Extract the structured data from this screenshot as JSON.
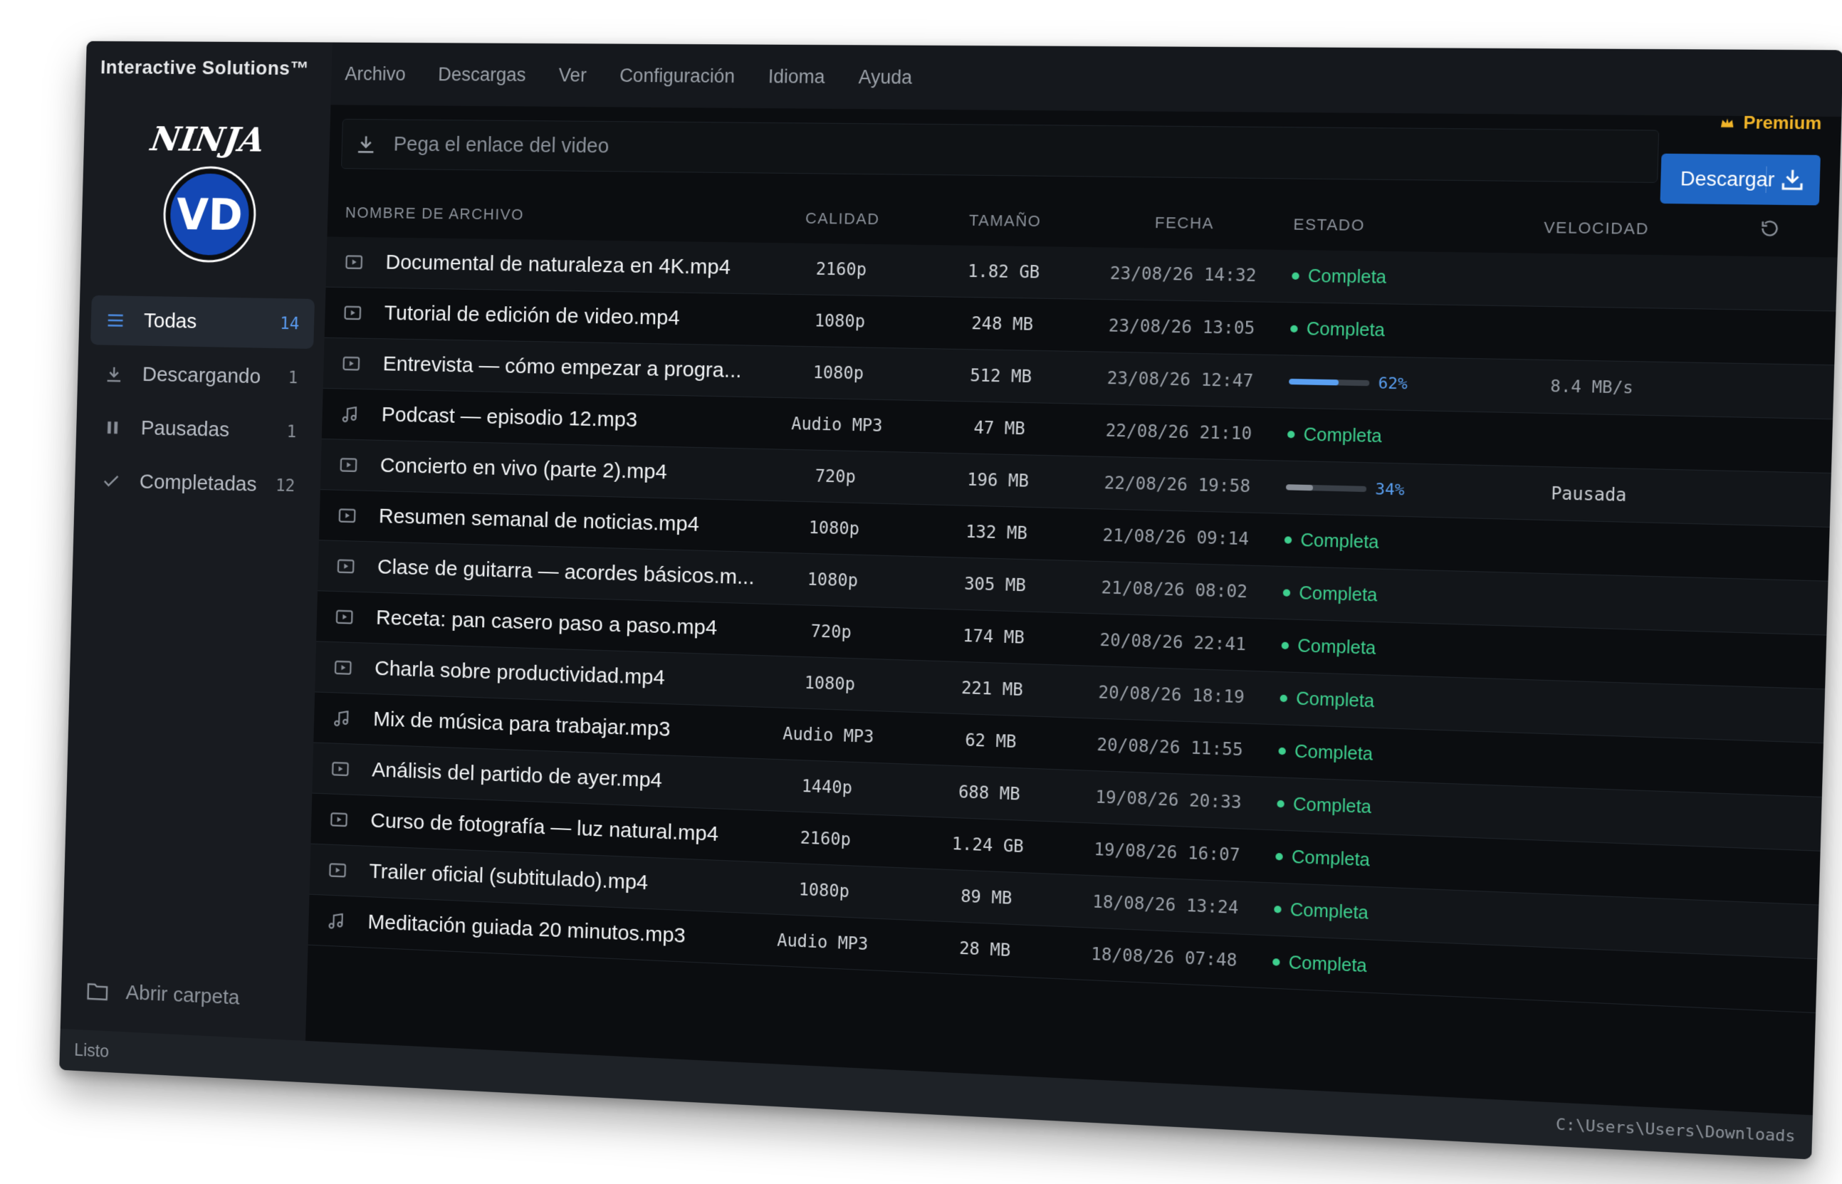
{
  "app": {
    "brand": "Interactive Solutions™",
    "logo_text_top": "NINJA",
    "logo_text_bottom": "VD"
  },
  "menu": [
    "Archivo",
    "Descargas",
    "Ver",
    "Configuración",
    "Idioma",
    "Ayuda"
  ],
  "sidebar": {
    "items": [
      {
        "label": "Todas",
        "count": "14",
        "icon": "list-icon",
        "active": true
      },
      {
        "label": "Descargando",
        "count": "1",
        "icon": "download-icon"
      },
      {
        "label": "Pausadas",
        "count": "1",
        "icon": "pause-icon"
      },
      {
        "label": "Completadas",
        "count": "12",
        "icon": "check-icon"
      }
    ],
    "open_folder": "Abrir carpeta"
  },
  "url_bar": {
    "placeholder": "Pega el enlace del video",
    "value": ""
  },
  "premium": {
    "label": "Premium",
    "color": "#f0b429"
  },
  "download_button": {
    "label": "Descargar",
    "color": "#1f66c4"
  },
  "table": {
    "headers": {
      "name": "NOMBRE DE ARCHIVO",
      "quality": "CALIDAD",
      "size": "TAMAÑO",
      "date": "FECHA",
      "status": "ESTADO",
      "speed": "VELOCIDAD"
    },
    "rows": [
      {
        "type": "video",
        "name": "Documental de naturaleza en 4K.mp4",
        "quality": "2160p",
        "size": "1.82 GB",
        "date": "23/08/26 14:32",
        "status": "Completa"
      },
      {
        "type": "video",
        "name": "Tutorial de edición de video.mp4",
        "quality": "1080p",
        "size": "248 MB",
        "date": "23/08/26 13:05",
        "status": "Completa"
      },
      {
        "type": "video",
        "name": "Entrevista — cómo empezar a progra...",
        "quality": "1080p",
        "size": "512 MB",
        "date": "23/08/26 12:47",
        "status": "progress",
        "progress": 62,
        "progress_label": "62%",
        "speed": "8.4 MB/s"
      },
      {
        "type": "audio",
        "name": "Podcast — episodio 12.mp3",
        "quality": "Audio MP3",
        "size": "47 MB",
        "date": "22/08/26 21:10",
        "status": "Completa"
      },
      {
        "type": "video",
        "name": "Concierto en vivo (parte 2).mp4",
        "quality": "720p",
        "size": "196 MB",
        "date": "22/08/26 19:58",
        "status": "paused",
        "progress": 34,
        "progress_label": "34%",
        "speed": "Pausada"
      },
      {
        "type": "video",
        "name": "Resumen semanal de noticias.mp4",
        "quality": "1080p",
        "size": "132 MB",
        "date": "21/08/26 09:14",
        "status": "Completa"
      },
      {
        "type": "video",
        "name": "Clase de guitarra — acordes básicos.m...",
        "quality": "1080p",
        "size": "305 MB",
        "date": "21/08/26 08:02",
        "status": "Completa"
      },
      {
        "type": "video",
        "name": "Receta: pan casero paso a paso.mp4",
        "quality": "720p",
        "size": "174 MB",
        "date": "20/08/26 22:41",
        "status": "Completa"
      },
      {
        "type": "video",
        "name": "Charla sobre productividad.mp4",
        "quality": "1080p",
        "size": "221 MB",
        "date": "20/08/26 18:19",
        "status": "Completa"
      },
      {
        "type": "audio",
        "name": "Mix de música para trabajar.mp3",
        "quality": "Audio MP3",
        "size": "62 MB",
        "date": "20/08/26 11:55",
        "status": "Completa"
      },
      {
        "type": "video",
        "name": "Análisis del partido de ayer.mp4",
        "quality": "1440p",
        "size": "688 MB",
        "date": "19/08/26 20:33",
        "status": "Completa"
      },
      {
        "type": "video",
        "name": "Curso de fotografía — luz natural.mp4",
        "quality": "2160p",
        "size": "1.24 GB",
        "date": "19/08/26 16:07",
        "status": "Completa"
      },
      {
        "type": "video",
        "name": "Trailer oficial (subtitulado).mp4",
        "quality": "1080p",
        "size": "89 MB",
        "date": "18/08/26 13:24",
        "status": "Completa"
      },
      {
        "type": "audio",
        "name": "Meditación guiada 20 minutos.mp3",
        "quality": "Audio MP3",
        "size": "28 MB",
        "date": "18/08/26 07:48",
        "status": "Completa"
      }
    ]
  },
  "statusbar": {
    "left": "Listo",
    "right": "C:\\Users\\Users\\Downloads"
  },
  "colors": {
    "accent": "#1f66c4",
    "success": "#3ecf8e",
    "progress": "#5aa0f2",
    "background": "#0b0d10"
  }
}
